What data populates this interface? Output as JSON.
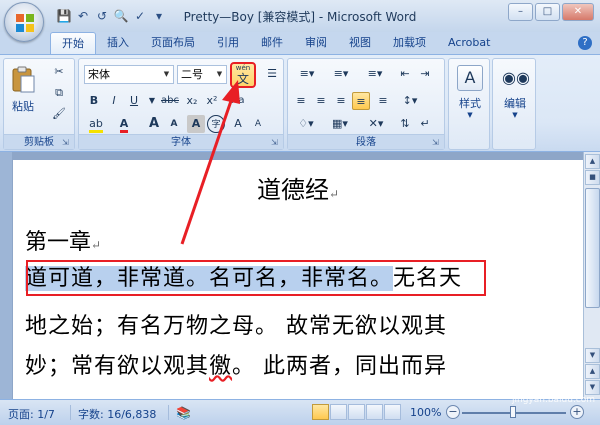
{
  "window": {
    "title": "Pretty—Boy [兼容模式] - Microsoft Word",
    "controls": [
      "–",
      "□",
      "✕"
    ]
  },
  "qat": {
    "icons": [
      "save-icon",
      "undo-icon",
      "redo-icon",
      "print-preview-icon",
      "spelling-icon",
      "customize-icon"
    ]
  },
  "tabs": [
    "开始",
    "插入",
    "页面布局",
    "引用",
    "邮件",
    "审阅",
    "视图",
    "加载项",
    "Acrobat"
  ],
  "ribbon": {
    "clipboard": {
      "label": "剪贴板",
      "paste": "粘贴"
    },
    "font": {
      "label": "字体",
      "font_name": "宋体",
      "font_size": "二号",
      "phonetic_guide": "wén",
      "phonetic_char": "文",
      "bold": "B",
      "italic": "I",
      "underline": "U",
      "strike": "abc",
      "subscript": "x₂",
      "superscript": "x²",
      "clear": "Aa",
      "grow": "A",
      "shrink": "A",
      "char_border": "A",
      "char_shade": "A",
      "enclose": "字",
      "grow_a": "A",
      "grow_b": "A"
    },
    "paragraph": {
      "label": "段落"
    },
    "styles": {
      "label": "样式"
    },
    "editing": {
      "label": "编辑"
    }
  },
  "document": {
    "title": "道德经",
    "heading": "第一章",
    "paragraph_mark": "↵",
    "line1_selected": "道可道，非常道。名可名，非常名。",
    "line1_rest": "无名天",
    "line2": "地之始；有名万物之母。  故常无欲以观其",
    "line3_pre": "妙；常有欲以观其",
    "line3_squiggle": "徼",
    "line3_post": "。  此两者，同出而异"
  },
  "status": {
    "page": "页面: 1/7",
    "words": "字数: 16/6,838",
    "zoom": "100%",
    "zoom_level": 1.0
  },
  "watermark": {
    "text": "Bai经验",
    "url": "jingyan.baidu.com"
  },
  "colors": {
    "highlight_box": "#e81f25",
    "selection": "#b8d0ee",
    "accent": "#15428b"
  }
}
